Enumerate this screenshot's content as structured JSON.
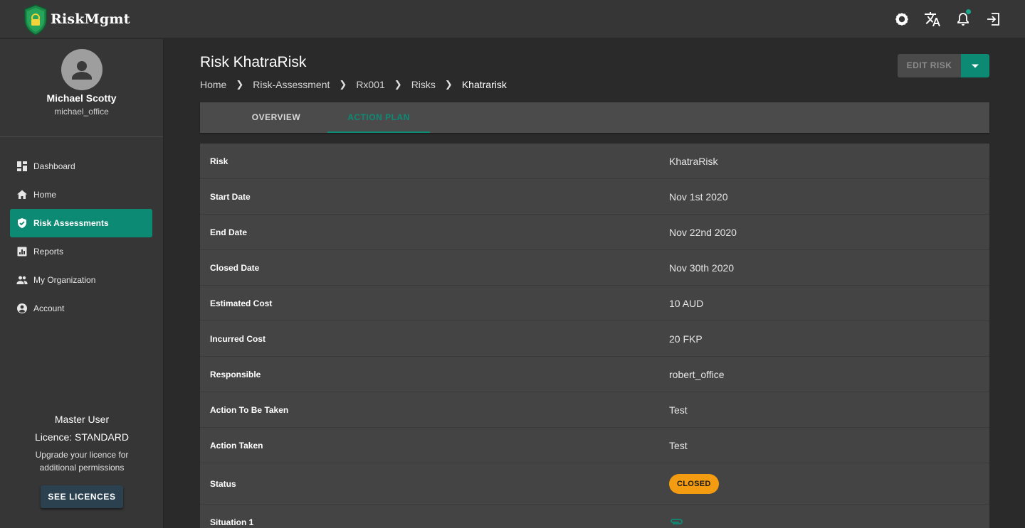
{
  "app": {
    "name": "RiskMgmt"
  },
  "topbar": {
    "icons": [
      "settings-icon",
      "translate-icon",
      "notification-icon",
      "logout-icon"
    ],
    "notification_dot_color": "#17a58a"
  },
  "user": {
    "name": "Michael Scotty",
    "handle": "michael_office"
  },
  "sidebar": {
    "items": [
      {
        "label": "Dashboard",
        "icon": "dashboard-icon",
        "active": false
      },
      {
        "label": "Home",
        "icon": "home-icon",
        "active": false
      },
      {
        "label": "Risk Assessments",
        "icon": "shield-check-icon",
        "active": true
      },
      {
        "label": "Reports",
        "icon": "reports-icon",
        "active": false
      },
      {
        "label": "My Organization",
        "icon": "people-icon",
        "active": false
      },
      {
        "label": "Account",
        "icon": "account-icon",
        "active": false
      }
    ]
  },
  "licence": {
    "role": "Master User",
    "type": "Licence: STANDARD",
    "note_line1": "Upgrade your licence for",
    "note_line2": "additional permissions",
    "button": "SEE LICENCES"
  },
  "page": {
    "title": "Risk KhatraRisk",
    "breadcrumb": [
      "Home",
      "Risk-Assessment",
      "Rx001",
      "Risks",
      "Khatrarisk"
    ],
    "edit_button": "EDIT RISK"
  },
  "tabs": [
    {
      "label": "OVERVIEW",
      "active": false
    },
    {
      "label": "ACTION PLAN",
      "active": true
    }
  ],
  "details": [
    {
      "key": "Risk",
      "value": "KhatraRisk"
    },
    {
      "key": "Start Date",
      "value": "Nov 1st 2020"
    },
    {
      "key": "End Date",
      "value": "Nov 22nd 2020"
    },
    {
      "key": "Closed Date",
      "value": "Nov 30th 2020"
    },
    {
      "key": "Estimated Cost",
      "value": "10 AUD"
    },
    {
      "key": "Incurred Cost",
      "value": "20 FKP"
    },
    {
      "key": "Responsible",
      "value": "robert_office"
    },
    {
      "key": "Action To Be Taken",
      "value": "Test"
    },
    {
      "key": "Action Taken",
      "value": "Test"
    },
    {
      "key": "Status",
      "value": "CLOSED"
    },
    {
      "key": "Situation 1",
      "value": ""
    }
  ],
  "colors": {
    "accent": "#0d8a74",
    "status_closed": "#f39c12",
    "attachment": "#0d8a74"
  }
}
